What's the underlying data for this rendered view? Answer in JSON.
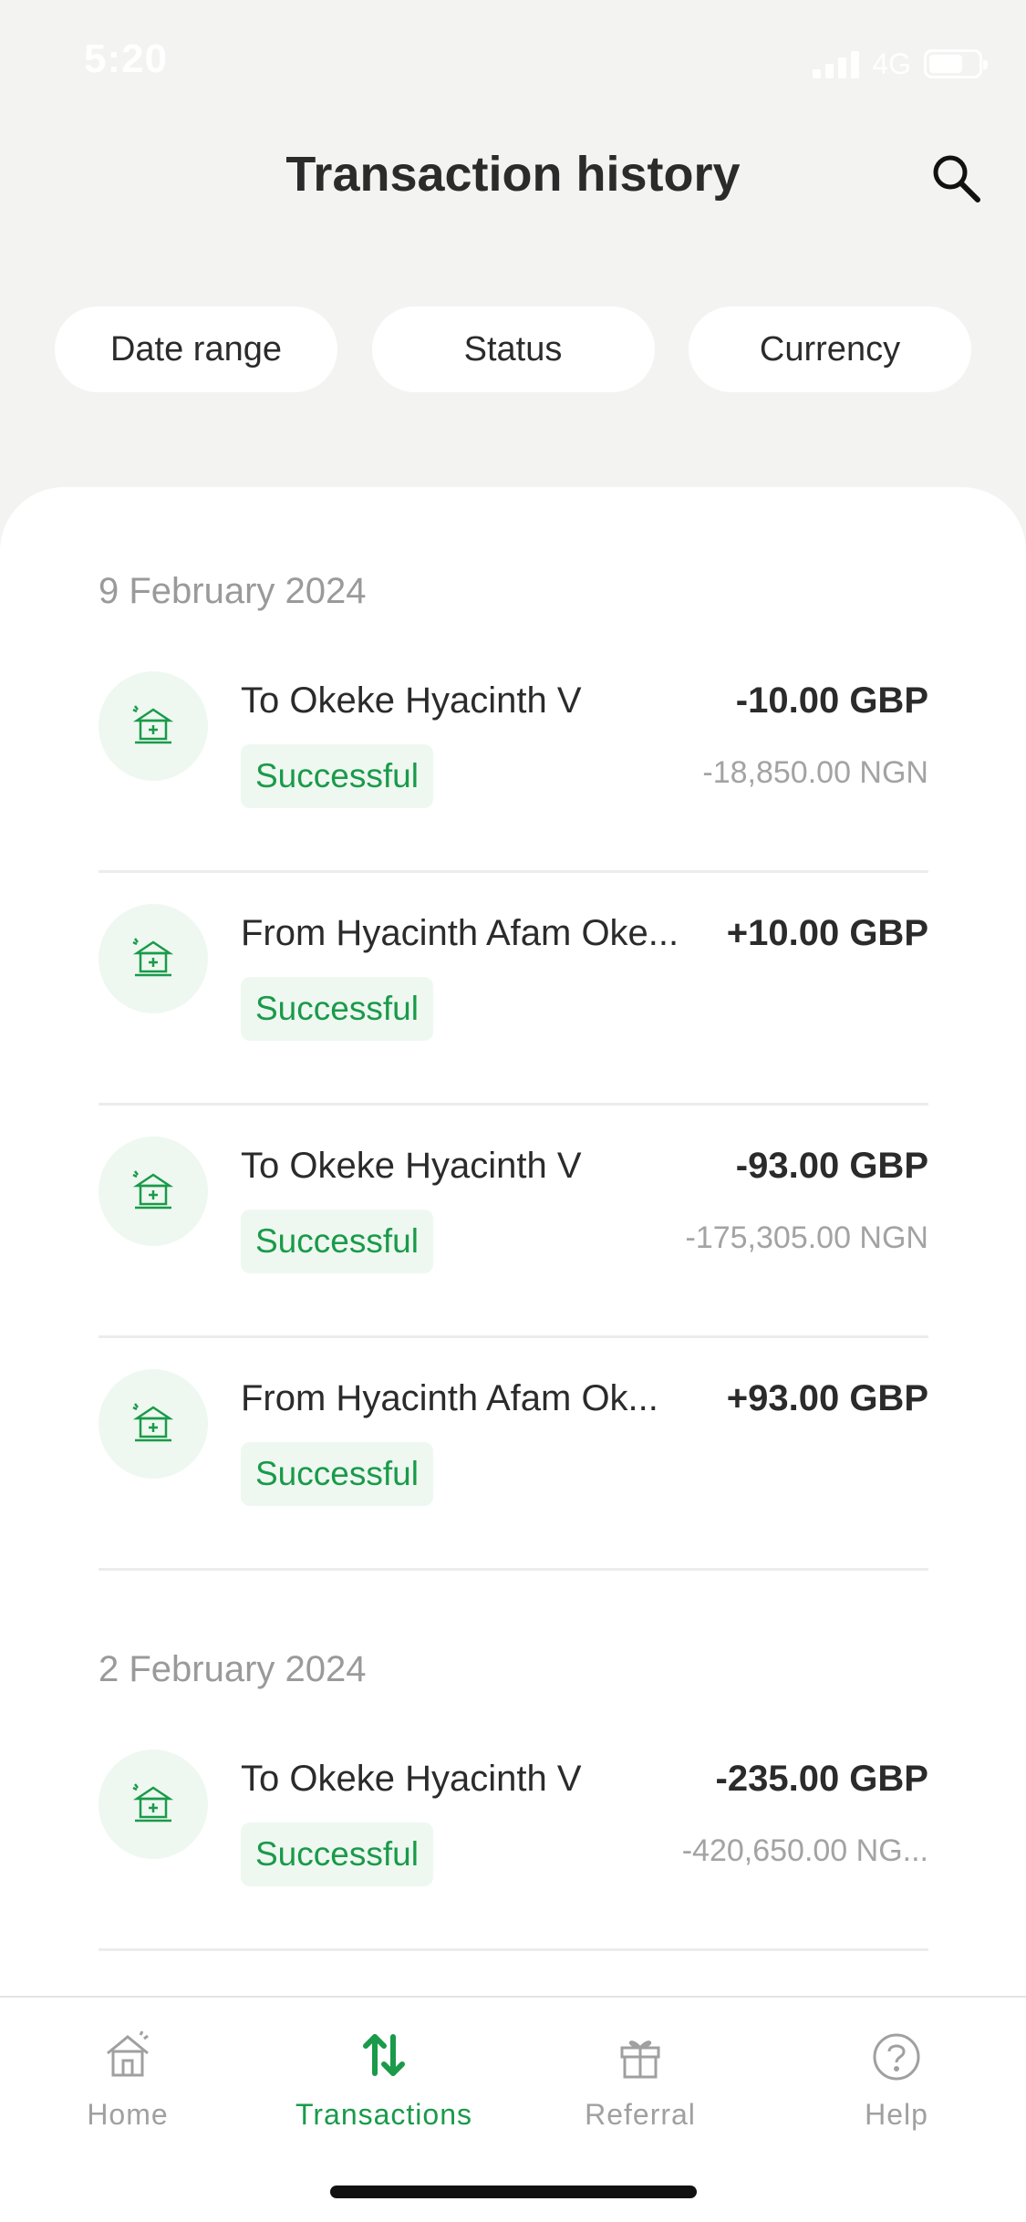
{
  "status_bar": {
    "time": "5:20",
    "network": "4G"
  },
  "header": {
    "title": "Transaction history",
    "search_icon": "search-icon"
  },
  "filters": [
    {
      "label": "Date range"
    },
    {
      "label": "Status"
    },
    {
      "label": "Currency"
    }
  ],
  "groups": [
    {
      "date": "9 February 2024",
      "transactions": [
        {
          "title": "To Okeke Hyacinth V",
          "amount": "-10.00 GBP",
          "status": "Successful",
          "converted": "-18,850.00 NGN",
          "icon": "bank-icon"
        },
        {
          "title": "From Hyacinth Afam Oke...",
          "amount": "+10.00 GBP",
          "status": "Successful",
          "converted": "",
          "icon": "bank-icon"
        },
        {
          "title": "To Okeke Hyacinth V",
          "amount": "-93.00 GBP",
          "status": "Successful",
          "converted": "-175,305.00 NGN",
          "icon": "bank-icon"
        },
        {
          "title": "From Hyacinth Afam Ok...",
          "amount": "+93.00 GBP",
          "status": "Successful",
          "converted": "",
          "icon": "bank-icon"
        }
      ]
    },
    {
      "date": "2 February 2024",
      "transactions": [
        {
          "title": "To Okeke Hyacinth V",
          "amount": "-235.00 GBP",
          "status": "Successful",
          "converted": "-420,650.00 NG...",
          "icon": "bank-icon"
        }
      ]
    }
  ],
  "tab_bar": {
    "tabs": [
      {
        "label": "Home",
        "icon": "home-icon",
        "active": false
      },
      {
        "label": "Transactions",
        "icon": "transfer-arrows-icon",
        "active": true
      },
      {
        "label": "Referral",
        "icon": "gift-icon",
        "active": false
      },
      {
        "label": "Help",
        "icon": "help-icon",
        "active": false
      }
    ]
  },
  "colors": {
    "accent": "#1a9a4a",
    "background": "#f3f3f1",
    "badge_bg": "#eef8f0"
  }
}
